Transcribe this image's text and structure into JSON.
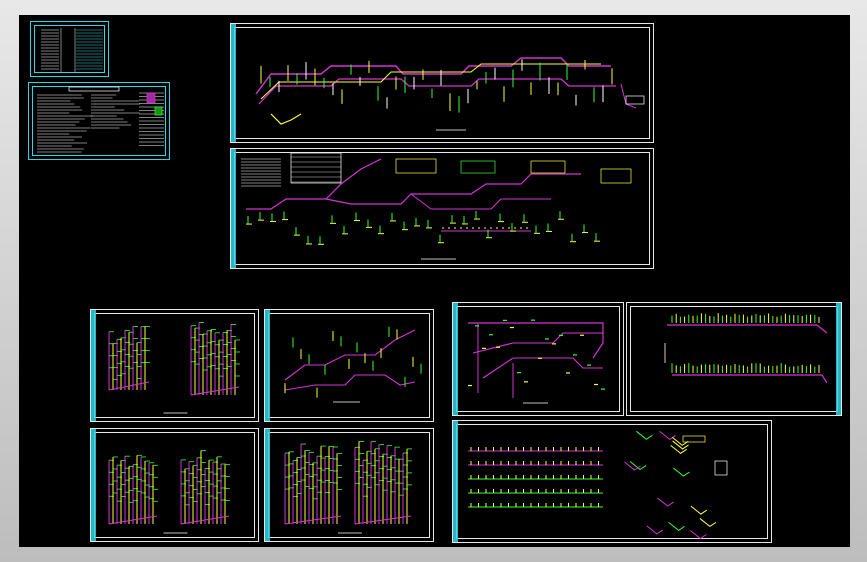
{
  "colors": {
    "background": "#000000",
    "sheet_border": "#e6e6e6",
    "title_strip": "#2fd6e6",
    "pipe_primary": "#d633d6",
    "pipe_secondary": "#ffff33",
    "pipe_tertiary": "#33ff33",
    "annotation": "#ffffff"
  },
  "sheets": [
    {
      "id": "legend-table"
    },
    {
      "id": "design-notes"
    },
    {
      "id": "system-schematic-top"
    },
    {
      "id": "system-schematic-mid"
    },
    {
      "id": "riser-a"
    },
    {
      "id": "riser-b"
    },
    {
      "id": "pipe-plan-a"
    },
    {
      "id": "pipe-plan-b"
    },
    {
      "id": "riser-c"
    },
    {
      "id": "riser-d"
    },
    {
      "id": "detail-plan"
    }
  ]
}
